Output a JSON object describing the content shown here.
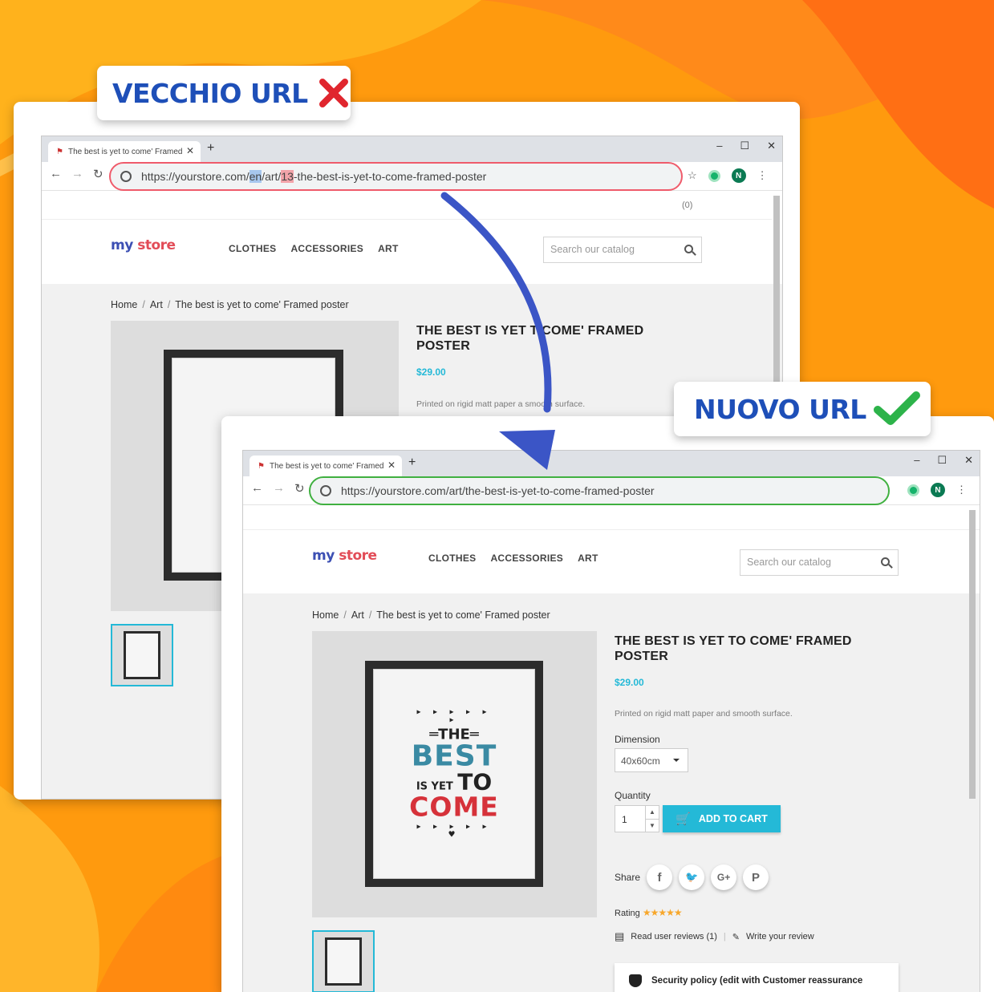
{
  "labels": {
    "old": "VECCHIO URL",
    "new": "NUOVO URL"
  },
  "old_browser": {
    "tab_title": "The best is yet to come' Framed",
    "url_prefix": "https://yourstore.com/",
    "url_lang": "en",
    "url_mid": "/art/",
    "url_id": "13",
    "url_rest": "-the-best-is-yet-to-come-framed-poster",
    "cart_count": "(0)"
  },
  "new_browser": {
    "tab_title": "The best is yet to come' Framed",
    "url": "https://yourstore.com/art/the-best-is-yet-to-come-framed-poster"
  },
  "store": {
    "logo_my": "my",
    "logo_store": "store",
    "menu": [
      "CLOTHES",
      "ACCESSORIES",
      "ART"
    ],
    "search_placeholder": "Search our catalog",
    "avatar_letter": "N"
  },
  "breadcrumb": [
    "Home",
    "Art",
    "The best is yet to come' Framed poster"
  ],
  "product": {
    "title_line1": "THE BEST IS YET TO COME' FRAMED",
    "title_line2": "POSTER",
    "price": "$29.00",
    "description": "Printed on rigid matt paper and smooth surface.",
    "dimension_label": "Dimension",
    "dimension_value": "40x60cm",
    "quantity_label": "Quantity",
    "quantity_value": "1",
    "add_to_cart": "ADD TO CART",
    "share_label": "Share",
    "rating_label": "Rating",
    "rating_stars": 5,
    "read_reviews": "Read user reviews (1)",
    "write_review": "Write your review",
    "reassurance": "Security policy (edit with Customer reassurance"
  },
  "old_product": {
    "title_line1_a": "THE BEST IS YET T",
    "title_line1_b": "COME' FRAMED",
    "title_line2": "POSTER",
    "price": "$29.00",
    "description_a": "Printed on rigid matt paper a",
    "description_b": "smooth surface."
  },
  "poster": {
    "arrows": "▸ ▸ ▸ ▸ ▸ ▸",
    "the": "THE",
    "best": "BEST",
    "is_yet": "IS YET",
    "to": "TO",
    "come": "COME",
    "arrows_bottom": "▸ ▸ ▸ ▸ ▸ ♥"
  },
  "colors": {
    "label_blue": "#1e4fb8",
    "cross_red": "#e0262e",
    "check_green": "#2db34a",
    "accent": "#24b9d7",
    "old_outline": "#ef5b6b",
    "new_outline": "#40b040"
  }
}
